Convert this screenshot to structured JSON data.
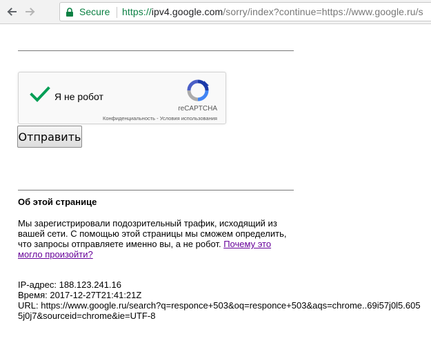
{
  "browser": {
    "secure_label": "Secure",
    "url": {
      "scheme": "https://",
      "host": "ipv4.google.com",
      "rest": "/sorry/index?continue=https://www.google.ru/s"
    }
  },
  "captcha": {
    "label": "Я не робот",
    "brand": "reCAPTCHA",
    "privacy_link": "Конфиденциальность",
    "links_separator": " - ",
    "terms_link": "Условия использования"
  },
  "form": {
    "submit_label": "Отправить"
  },
  "about": {
    "heading": "Об этой странице",
    "body": "Мы зарегистрировали подозрительный трафик, исходящий из вашей сети. С помощью этой страницы мы сможем определить, что запросы отправляете именно вы, а не робот. ",
    "why_link": "Почему это могло произойти?"
  },
  "info": {
    "ip_label": "IP-адрес: ",
    "ip_value": "188.123.241.16",
    "time_label": "Время: ",
    "time_value": "2017-12-27T21:41:21Z",
    "url_label": "URL: ",
    "url_value": "https://www.google.ru/search?q=responce+503&oq=responce+503&aqs=chrome..69i57j0l5.6055j0j7&sourceid=chrome&ie=UTF-8"
  },
  "colors": {
    "secure_green": "#0b8043",
    "check_green": "#009e55",
    "visited_link": "#660099"
  },
  "icons": [
    "back-arrow-icon",
    "forward-arrow-icon",
    "lock-icon",
    "checkmark-icon",
    "recaptcha-logo-icon"
  ]
}
